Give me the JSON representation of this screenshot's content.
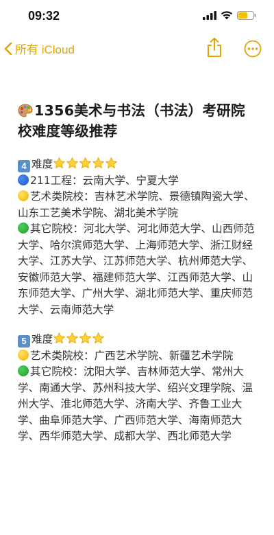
{
  "status_bar": {
    "time": "09:32"
  },
  "nav": {
    "back_label": "所有 iCloud",
    "accent_color": "#e0a500"
  },
  "note": {
    "title_emoji": "palette-icon",
    "title": "1356美术与书法（书法）考研院校难度等级推荐",
    "sections": [
      {
        "level_badge": "4",
        "level_label": "难度",
        "stars": 5,
        "groups": [
          {
            "dot": "blue",
            "text": "211工程：云南大学、宁夏大学"
          },
          {
            "dot": "yellow",
            "text": "艺术类院校：吉林艺术学院、景德镇陶瓷大学、山东工艺美术学院、湖北美术学院"
          },
          {
            "dot": "green",
            "text": "其它院校：河北大学、河北师范大学、山西师范大学、哈尔滨师范大学、上海师范大学、浙江财经大学、江苏大学、江苏师范大学、杭州师范大学、安徽师范大学、福建师范大学、江西师范大学、山东师范大学、广州大学、湖北师范大学、重庆师范大学、云南师范大学"
          }
        ]
      },
      {
        "level_badge": "5",
        "level_label": "难度",
        "stars": 4,
        "groups": [
          {
            "dot": "yellow",
            "text": "艺术类院校：广西艺术学院、新疆艺术学院"
          },
          {
            "dot": "green",
            "text": "其它院校：沈阳大学、吉林师范大学、常州大学、南通大学、苏州科技大学、绍兴文理学院、温州大学、淮北师范大学、济南大学、齐鲁工业大学、曲阜师范大学、广西师范大学、海南师范大学、西华师范大学、成都大学、西北师范大学"
          }
        ]
      }
    ]
  }
}
